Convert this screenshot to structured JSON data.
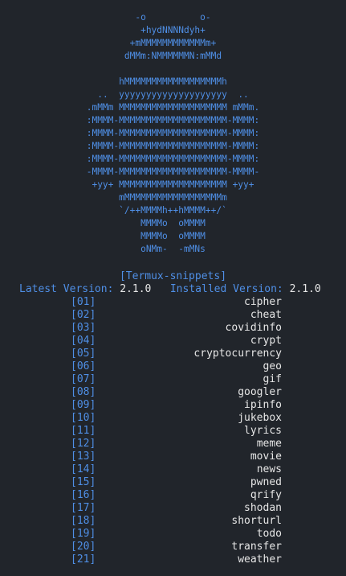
{
  "ascii_art": [
    "-o          o-",
    "+hydNNNNdyh+",
    "+mMMMMMMMMMMMMm+",
    "dMMm:NMMMMMMN:mMMd",
    "",
    "hMMMMMMMMMMMMMMMMMMh",
    "..  yyyyyyyyyyyyyyyyyyyy  ..",
    ".mMMm MMMMMMMMMMMMMMMMMMMM mMMm.",
    ":MMMM-MMMMMMMMMMMMMMMMMMMM-MMMM:",
    ":MMMM-MMMMMMMMMMMMMMMMMMMM-MMMM:",
    ":MMMM-MMMMMMMMMMMMMMMMMMMM-MMMM:",
    ":MMMM-MMMMMMMMMMMMMMMMMMMM-MMMM:",
    "-MMMM-MMMMMMMMMMMMMMMMMMMM-MMMM-",
    "+yy+ MMMMMMMMMMMMMMMMMMMM +yy+",
    "mMMMMMMMMMMMMMMMMMMm",
    "`/++MMMMh++hMMMM++/`",
    "MMMMo  oMMMM",
    "MMMMo  oMMMM",
    "oNMm-  -mMNs"
  ],
  "title": "[Termux-snippets]",
  "latest_label": "Latest Version:",
  "latest_value": "2.1.0",
  "installed_label": "Installed Version:",
  "installed_value": "2.1.0",
  "menu": [
    {
      "num": "[01]",
      "name": "cipher"
    },
    {
      "num": "[02]",
      "name": "cheat"
    },
    {
      "num": "[03]",
      "name": "covidinfo"
    },
    {
      "num": "[04]",
      "name": "crypt"
    },
    {
      "num": "[05]",
      "name": "cryptocurrency"
    },
    {
      "num": "[06]",
      "name": "geo"
    },
    {
      "num": "[07]",
      "name": "gif"
    },
    {
      "num": "[08]",
      "name": "googler"
    },
    {
      "num": "[09]",
      "name": "ipinfo"
    },
    {
      "num": "[10]",
      "name": "jukebox"
    },
    {
      "num": "[11]",
      "name": "lyrics"
    },
    {
      "num": "[12]",
      "name": "meme"
    },
    {
      "num": "[13]",
      "name": "movie"
    },
    {
      "num": "[14]",
      "name": "news"
    },
    {
      "num": "[15]",
      "name": "pwned"
    },
    {
      "num": "[16]",
      "name": "qrify"
    },
    {
      "num": "[17]",
      "name": "shodan"
    },
    {
      "num": "[18]",
      "name": "shorturl"
    },
    {
      "num": "[19]",
      "name": "todo"
    },
    {
      "num": "[20]",
      "name": "transfer"
    },
    {
      "num": "[21]",
      "name": "weather"
    }
  ]
}
